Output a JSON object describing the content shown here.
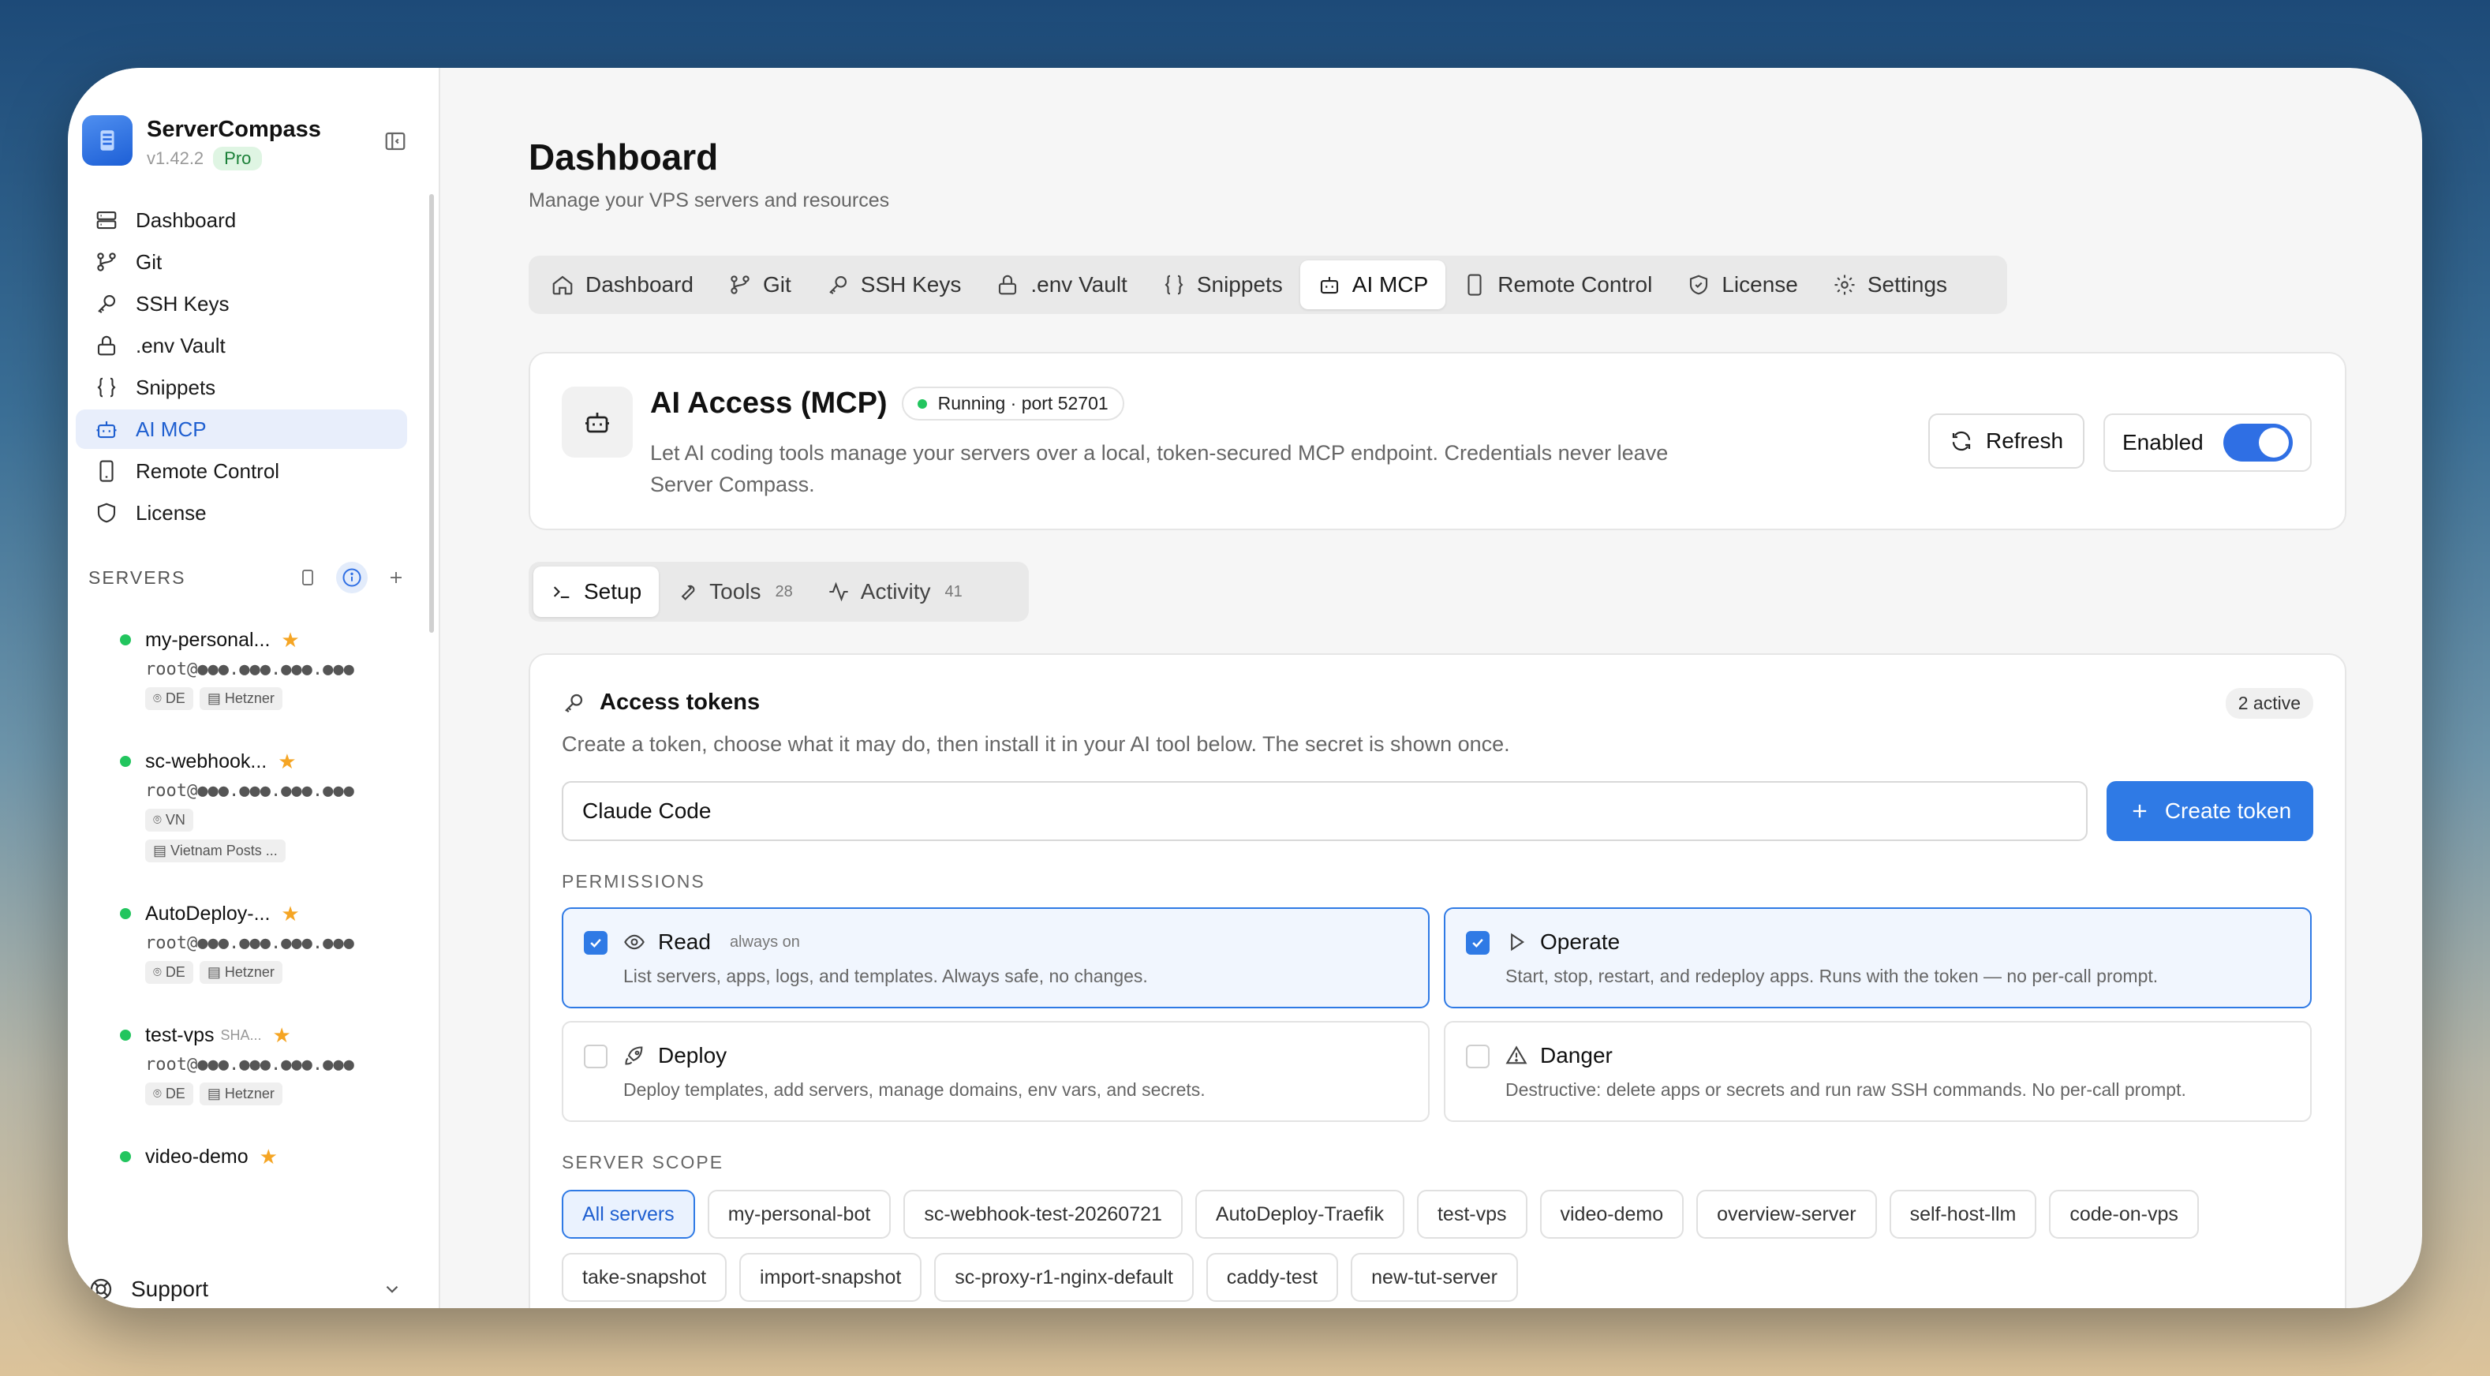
{
  "app": {
    "name": "ServerCompass",
    "version": "v1.42.2",
    "plan": "Pro"
  },
  "sidebar": {
    "items": [
      {
        "label": "Dashboard",
        "icon": "dashboard-icon"
      },
      {
        "label": "Git",
        "icon": "git-icon"
      },
      {
        "label": "SSH Keys",
        "icon": "key-icon"
      },
      {
        "label": ".env Vault",
        "icon": "lock-icon"
      },
      {
        "label": "Snippets",
        "icon": "braces-icon"
      },
      {
        "label": "AI MCP",
        "icon": "bot-icon"
      },
      {
        "label": "Remote Control",
        "icon": "phone-icon"
      },
      {
        "label": "License",
        "icon": "shield-icon"
      }
    ],
    "active_item": "AI MCP",
    "servers_label": "SERVERS",
    "servers": [
      {
        "name": "my-personal...",
        "meta": "",
        "user": "root@●●●.●●●.●●●.●●●",
        "tags": [
          "DE",
          "Hetzner"
        ]
      },
      {
        "name": "sc-webhook...",
        "meta": "",
        "user": "root@●●●.●●●.●●●.●●●",
        "tags": [
          "VN",
          "Vietnam Posts ..."
        ]
      },
      {
        "name": "AutoDeploy-...",
        "meta": "",
        "user": "root@●●●.●●●.●●●.●●●",
        "tags": [
          "DE",
          "Hetzner"
        ]
      },
      {
        "name": "test-vps",
        "meta": "SHA...",
        "user": "root@●●●.●●●.●●●.●●●",
        "tags": [
          "DE",
          "Hetzner"
        ]
      },
      {
        "name": "video-demo",
        "meta": "",
        "user": "",
        "tags": []
      }
    ],
    "support_label": "Support"
  },
  "header": {
    "title": "Dashboard",
    "subtitle": "Manage your VPS servers and resources"
  },
  "topnav": {
    "tabs": [
      {
        "label": "Dashboard"
      },
      {
        "label": "Git"
      },
      {
        "label": "SSH Keys"
      },
      {
        "label": ".env Vault"
      },
      {
        "label": "Snippets"
      },
      {
        "label": "AI MCP"
      },
      {
        "label": "Remote Control"
      },
      {
        "label": "License"
      },
      {
        "label": "Settings"
      }
    ],
    "active": "AI MCP"
  },
  "mcp": {
    "title": "AI Access (MCP)",
    "status": "Running · port 52701",
    "description": "Let AI coding tools manage your servers over a local, token-secured MCP endpoint. Credentials never leave Server Compass.",
    "refresh_label": "Refresh",
    "enabled_label": "Enabled",
    "enabled": true
  },
  "subtabs": [
    {
      "label": "Setup",
      "count": ""
    },
    {
      "label": "Tools",
      "count": "28"
    },
    {
      "label": "Activity",
      "count": "41"
    }
  ],
  "tokens": {
    "title": "Access tokens",
    "badge": "2 active",
    "description": "Create a token, choose what it may do, then install it in your AI tool below. The secret is shown once.",
    "name_value": "Claude Code",
    "create_label": "Create token",
    "permissions_label": "PERMISSIONS",
    "permissions": [
      {
        "title": "Read",
        "note": "always on",
        "desc": "List servers, apps, logs, and templates. Always safe, no changes.",
        "checked": true
      },
      {
        "title": "Operate",
        "note": "",
        "desc": "Start, stop, restart, and redeploy apps. Runs with the token — no per-call prompt.",
        "checked": true
      },
      {
        "title": "Deploy",
        "note": "",
        "desc": "Deploy templates, add servers, manage domains, env vars, and secrets.",
        "checked": false
      },
      {
        "title": "Danger",
        "note": "",
        "desc": "Destructive: delete apps or secrets and run raw SSH commands. No per-call prompt.",
        "checked": false
      }
    ],
    "scope_label": "SERVER SCOPE",
    "scopes": [
      "All servers",
      "my-personal-bot",
      "sc-webhook-test-20260721",
      "AutoDeploy-Traefik",
      "test-vps",
      "video-demo",
      "overview-server",
      "self-host-llm",
      "code-on-vps",
      "take-snapshot",
      "import-snapshot",
      "sc-proxy-r1-nginx-default",
      "caddy-test",
      "new-tut-server"
    ],
    "selected_scope": "All servers"
  },
  "colors": {
    "accent": "#2f7ae5",
    "status_green": "#22c55e",
    "star": "#f5a524"
  }
}
